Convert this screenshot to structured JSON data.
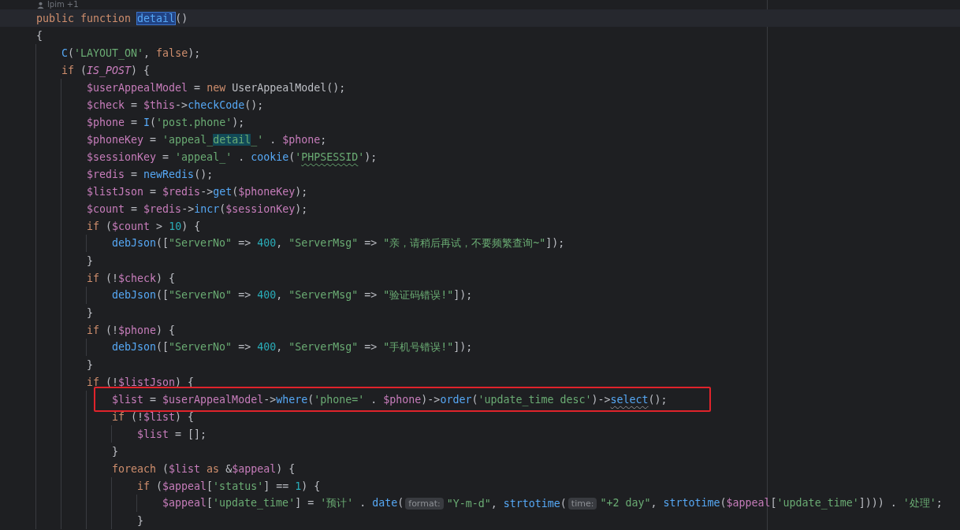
{
  "author_hint": {
    "text": "lpim +1"
  },
  "lines": [
    {
      "current": true,
      "tokens": [
        {
          "kind": "kw",
          "text": "public function "
        },
        {
          "kind": "fn_decl",
          "text": "detail",
          "selected": true
        },
        {
          "kind": "plain",
          "text": "()"
        }
      ]
    },
    {
      "tokens": [
        {
          "kind": "plain",
          "text": "{"
        }
      ],
      "children": [
        {
          "tokens": [
            {
              "kind": "fn",
              "text": "C"
            },
            {
              "kind": "plain",
              "text": "("
            },
            {
              "kind": "str",
              "text": "'LAYOUT_ON'"
            },
            {
              "kind": "plain",
              "text": ", "
            },
            {
              "kind": "kw",
              "text": "false"
            },
            {
              "kind": "plain",
              "text": ");"
            }
          ]
        },
        {
          "tokens": [
            {
              "kind": "kw",
              "text": "if "
            },
            {
              "kind": "plain",
              "text": "("
            },
            {
              "kind": "const",
              "text": "IS_POST"
            },
            {
              "kind": "plain",
              "text": ") {"
            }
          ],
          "children": [
            {
              "tokens": [
                {
                  "kind": "var",
                  "text": "$userAppealModel"
                },
                {
                  "kind": "plain",
                  "text": " = "
                },
                {
                  "kind": "kw",
                  "text": "new "
                },
                {
                  "kind": "plain",
                  "text": "UserAppealModel();"
                }
              ]
            },
            {
              "tokens": [
                {
                  "kind": "var",
                  "text": "$check"
                },
                {
                  "kind": "plain",
                  "text": " = "
                },
                {
                  "kind": "var",
                  "text": "$this"
                },
                {
                  "kind": "plain",
                  "text": "->"
                },
                {
                  "kind": "fn",
                  "text": "checkCode"
                },
                {
                  "kind": "plain",
                  "text": "();"
                }
              ]
            },
            {
              "tokens": [
                {
                  "kind": "var",
                  "text": "$phone"
                },
                {
                  "kind": "plain",
                  "text": " = "
                },
                {
                  "kind": "fn",
                  "text": "I"
                },
                {
                  "kind": "plain",
                  "text": "("
                },
                {
                  "kind": "str",
                  "text": "'post.phone'"
                },
                {
                  "kind": "plain",
                  "text": ");"
                }
              ]
            },
            {
              "tokens": [
                {
                  "kind": "var",
                  "text": "$phoneKey"
                },
                {
                  "kind": "plain",
                  "text": " = "
                },
                {
                  "kind": "str",
                  "text": "'appeal_"
                },
                {
                  "kind": "str",
                  "text": "detail",
                  "occurrence": true
                },
                {
                  "kind": "str",
                  "text": "_'"
                },
                {
                  "kind": "plain",
                  "text": " . "
                },
                {
                  "kind": "var",
                  "text": "$phone"
                },
                {
                  "kind": "plain",
                  "text": ";"
                }
              ]
            },
            {
              "tokens": [
                {
                  "kind": "var",
                  "text": "$sessionKey"
                },
                {
                  "kind": "plain",
                  "text": " = "
                },
                {
                  "kind": "str",
                  "text": "'appeal_'"
                },
                {
                  "kind": "plain",
                  "text": " . "
                },
                {
                  "kind": "fn",
                  "text": "cookie"
                },
                {
                  "kind": "plain",
                  "text": "("
                },
                {
                  "kind": "str",
                  "text": "'"
                },
                {
                  "kind": "str",
                  "text": "PHPSESSID",
                  "typo": true
                },
                {
                  "kind": "str",
                  "text": "'"
                },
                {
                  "kind": "plain",
                  "text": ");"
                }
              ]
            },
            {
              "tokens": [
                {
                  "kind": "var",
                  "text": "$redis"
                },
                {
                  "kind": "plain",
                  "text": " = "
                },
                {
                  "kind": "fn",
                  "text": "newRedis"
                },
                {
                  "kind": "plain",
                  "text": "();"
                }
              ]
            },
            {
              "tokens": [
                {
                  "kind": "var",
                  "text": "$listJson"
                },
                {
                  "kind": "plain",
                  "text": " = "
                },
                {
                  "kind": "var",
                  "text": "$redis"
                },
                {
                  "kind": "plain",
                  "text": "->"
                },
                {
                  "kind": "fn",
                  "text": "get"
                },
                {
                  "kind": "plain",
                  "text": "("
                },
                {
                  "kind": "var",
                  "text": "$phoneKey"
                },
                {
                  "kind": "plain",
                  "text": ");"
                }
              ]
            },
            {
              "tokens": [
                {
                  "kind": "var",
                  "text": "$count"
                },
                {
                  "kind": "plain",
                  "text": " = "
                },
                {
                  "kind": "var",
                  "text": "$redis"
                },
                {
                  "kind": "plain",
                  "text": "->"
                },
                {
                  "kind": "fn",
                  "text": "incr"
                },
                {
                  "kind": "plain",
                  "text": "("
                },
                {
                  "kind": "var",
                  "text": "$sessionKey"
                },
                {
                  "kind": "plain",
                  "text": ");"
                }
              ]
            },
            {
              "tokens": [
                {
                  "kind": "kw",
                  "text": "if "
                },
                {
                  "kind": "plain",
                  "text": "("
                },
                {
                  "kind": "var",
                  "text": "$count"
                },
                {
                  "kind": "plain",
                  "text": " > "
                },
                {
                  "kind": "num",
                  "text": "10"
                },
                {
                  "kind": "plain",
                  "text": ") {"
                }
              ],
              "children": [
                {
                  "tokens": [
                    {
                      "kind": "fn",
                      "text": "debJson"
                    },
                    {
                      "kind": "plain",
                      "text": "(["
                    },
                    {
                      "kind": "str",
                      "text": "\"ServerNo\""
                    },
                    {
                      "kind": "plain",
                      "text": " => "
                    },
                    {
                      "kind": "num",
                      "text": "400"
                    },
                    {
                      "kind": "plain",
                      "text": ", "
                    },
                    {
                      "kind": "str",
                      "text": "\"ServerMsg\""
                    },
                    {
                      "kind": "plain",
                      "text": " => "
                    },
                    {
                      "kind": "str",
                      "text": "\"亲，请稍后再试，不要频繁查询~\""
                    },
                    {
                      "kind": "plain",
                      "text": "]);"
                    }
                  ]
                }
              ]
            },
            {
              "tokens": [
                {
                  "kind": "plain",
                  "text": "}"
                }
              ]
            },
            {
              "tokens": [
                {
                  "kind": "kw",
                  "text": "if "
                },
                {
                  "kind": "plain",
                  "text": "(!"
                },
                {
                  "kind": "var",
                  "text": "$check"
                },
                {
                  "kind": "plain",
                  "text": ") {"
                }
              ],
              "children": [
                {
                  "tokens": [
                    {
                      "kind": "fn",
                      "text": "debJson"
                    },
                    {
                      "kind": "plain",
                      "text": "(["
                    },
                    {
                      "kind": "str",
                      "text": "\"ServerNo\""
                    },
                    {
                      "kind": "plain",
                      "text": " => "
                    },
                    {
                      "kind": "num",
                      "text": "400"
                    },
                    {
                      "kind": "plain",
                      "text": ", "
                    },
                    {
                      "kind": "str",
                      "text": "\"ServerMsg\""
                    },
                    {
                      "kind": "plain",
                      "text": " => "
                    },
                    {
                      "kind": "str",
                      "text": "\"验证码错误!\""
                    },
                    {
                      "kind": "plain",
                      "text": "]);"
                    }
                  ]
                }
              ]
            },
            {
              "tokens": [
                {
                  "kind": "plain",
                  "text": "}"
                }
              ]
            },
            {
              "tokens": [
                {
                  "kind": "kw",
                  "text": "if "
                },
                {
                  "kind": "plain",
                  "text": "(!"
                },
                {
                  "kind": "var",
                  "text": "$phone"
                },
                {
                  "kind": "plain",
                  "text": ") {"
                }
              ],
              "children": [
                {
                  "tokens": [
                    {
                      "kind": "fn",
                      "text": "debJson"
                    },
                    {
                      "kind": "plain",
                      "text": "(["
                    },
                    {
                      "kind": "str",
                      "text": "\"ServerNo\""
                    },
                    {
                      "kind": "plain",
                      "text": " => "
                    },
                    {
                      "kind": "num",
                      "text": "400"
                    },
                    {
                      "kind": "plain",
                      "text": ", "
                    },
                    {
                      "kind": "str",
                      "text": "\"ServerMsg\""
                    },
                    {
                      "kind": "plain",
                      "text": " => "
                    },
                    {
                      "kind": "str",
                      "text": "\"手机号错误!\""
                    },
                    {
                      "kind": "plain",
                      "text": "]);"
                    }
                  ]
                }
              ]
            },
            {
              "tokens": [
                {
                  "kind": "plain",
                  "text": "}"
                }
              ]
            },
            {
              "tokens": [
                {
                  "kind": "kw",
                  "text": "if "
                },
                {
                  "kind": "plain",
                  "text": "(!"
                },
                {
                  "kind": "var",
                  "text": "$listJson"
                },
                {
                  "kind": "plain",
                  "text": ") {"
                }
              ],
              "children": [
                {
                  "boxed": true,
                  "tokens": [
                    {
                      "kind": "var",
                      "text": "$list"
                    },
                    {
                      "kind": "plain",
                      "text": " = "
                    },
                    {
                      "kind": "var",
                      "text": "$userAppealModel"
                    },
                    {
                      "kind": "plain",
                      "text": "->"
                    },
                    {
                      "kind": "fn",
                      "text": "where"
                    },
                    {
                      "kind": "plain",
                      "text": "("
                    },
                    {
                      "kind": "str",
                      "text": "'phone='"
                    },
                    {
                      "kind": "plain",
                      "text": " . "
                    },
                    {
                      "kind": "var",
                      "text": "$phone"
                    },
                    {
                      "kind": "plain",
                      "text": ")->"
                    },
                    {
                      "kind": "fn",
                      "text": "order"
                    },
                    {
                      "kind": "plain",
                      "text": "("
                    },
                    {
                      "kind": "str",
                      "text": "'update_time desc'"
                    },
                    {
                      "kind": "plain",
                      "text": ")->"
                    },
                    {
                      "kind": "fn",
                      "text": "select",
                      "warning": true
                    },
                    {
                      "kind": "plain",
                      "text": "();"
                    }
                  ]
                },
                {
                  "tokens": [
                    {
                      "kind": "kw",
                      "text": "if "
                    },
                    {
                      "kind": "plain",
                      "text": "(!"
                    },
                    {
                      "kind": "var",
                      "text": "$list"
                    },
                    {
                      "kind": "plain",
                      "text": ") {"
                    }
                  ],
                  "children": [
                    {
                      "tokens": [
                        {
                          "kind": "var",
                          "text": "$list"
                        },
                        {
                          "kind": "plain",
                          "text": " = [];"
                        }
                      ]
                    }
                  ]
                },
                {
                  "tokens": [
                    {
                      "kind": "plain",
                      "text": "}"
                    }
                  ]
                },
                {
                  "tokens": [
                    {
                      "kind": "kw",
                      "text": "foreach "
                    },
                    {
                      "kind": "plain",
                      "text": "("
                    },
                    {
                      "kind": "var",
                      "text": "$list"
                    },
                    {
                      "kind": "kw",
                      "text": " as"
                    },
                    {
                      "kind": "plain",
                      "text": " &"
                    },
                    {
                      "kind": "var",
                      "text": "$appeal"
                    },
                    {
                      "kind": "plain",
                      "text": ") {"
                    }
                  ],
                  "children": [
                    {
                      "tokens": [
                        {
                          "kind": "kw",
                          "text": "if "
                        },
                        {
                          "kind": "plain",
                          "text": "("
                        },
                        {
                          "kind": "var",
                          "text": "$appeal"
                        },
                        {
                          "kind": "plain",
                          "text": "["
                        },
                        {
                          "kind": "str",
                          "text": "'status'"
                        },
                        {
                          "kind": "plain",
                          "text": "] == "
                        },
                        {
                          "kind": "num",
                          "text": "1"
                        },
                        {
                          "kind": "plain",
                          "text": ") {"
                        }
                      ],
                      "children": [
                        {
                          "tokens": [
                            {
                              "kind": "var",
                              "text": "$appeal"
                            },
                            {
                              "kind": "plain",
                              "text": "["
                            },
                            {
                              "kind": "str",
                              "text": "'update_time'"
                            },
                            {
                              "kind": "plain",
                              "text": "] = "
                            },
                            {
                              "kind": "str",
                              "text": "'预计'"
                            },
                            {
                              "kind": "plain",
                              "text": " . "
                            },
                            {
                              "kind": "fn",
                              "text": "date"
                            },
                            {
                              "kind": "plain",
                              "text": "("
                            },
                            {
                              "kind": "hint",
                              "text": "format:"
                            },
                            {
                              "kind": "str",
                              "text": "\"Y-m-d\""
                            },
                            {
                              "kind": "plain",
                              "text": ", "
                            },
                            {
                              "kind": "fn",
                              "text": "strtotime"
                            },
                            {
                              "kind": "plain",
                              "text": "("
                            },
                            {
                              "kind": "hint",
                              "text": "time:"
                            },
                            {
                              "kind": "str",
                              "text": "\"+2 day\""
                            },
                            {
                              "kind": "plain",
                              "text": ", "
                            },
                            {
                              "kind": "fn",
                              "text": "strtotime"
                            },
                            {
                              "kind": "plain",
                              "text": "("
                            },
                            {
                              "kind": "var",
                              "text": "$appeal"
                            },
                            {
                              "kind": "plain",
                              "text": "["
                            },
                            {
                              "kind": "str",
                              "text": "'update_time'"
                            },
                            {
                              "kind": "plain",
                              "text": "]))) . "
                            },
                            {
                              "kind": "str",
                              "text": "'处理'"
                            },
                            {
                              "kind": "plain",
                              "text": ";"
                            }
                          ]
                        }
                      ]
                    },
                    {
                      "tokens": [
                        {
                          "kind": "plain",
                          "text": "}"
                        }
                      ]
                    }
                  ]
                }
              ]
            }
          ]
        }
      ]
    }
  ]
}
